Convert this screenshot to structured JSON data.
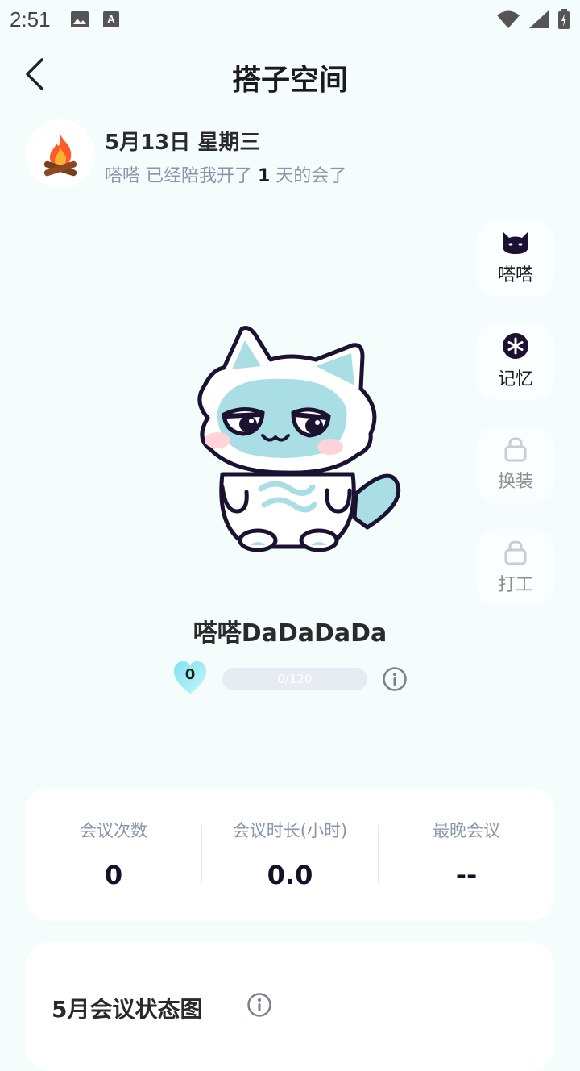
{
  "status_bar": {
    "time": "2:51",
    "icons_left": [
      "image-icon",
      "font-icon"
    ],
    "icons_right": [
      "wifi-icon",
      "signal-icon",
      "battery-icon"
    ]
  },
  "header": {
    "title": "搭子空间",
    "back_icon": "chevron-left-icon"
  },
  "info": {
    "date": "5月13日 星期三",
    "companion_prefix": "嗒嗒 已经陪我开了 ",
    "companion_days": "1",
    "companion_suffix": " 天的会了",
    "avatar_icon": "campfire-icon"
  },
  "side_menu": [
    {
      "label": "嗒嗒",
      "icon": "cat-head-icon",
      "locked": false
    },
    {
      "label": "记忆",
      "icon": "asterisk-icon",
      "locked": false
    },
    {
      "label": "换装",
      "icon": "lock-icon",
      "locked": true
    },
    {
      "label": "打工",
      "icon": "lock-icon",
      "locked": true
    }
  ],
  "pet": {
    "name": "嗒嗒DaDaDaDa",
    "level": "0",
    "progress_text": "0/120",
    "progress_fraction": 0
  },
  "stats": [
    {
      "label": "会议次数",
      "value": "0"
    },
    {
      "label": "会议时长(小时)",
      "value": "0.0"
    },
    {
      "label": "最晚会议",
      "value": "--"
    }
  ],
  "month_chart": {
    "title": "5月会议状态图"
  },
  "colors": {
    "background": "#f5fcfc",
    "accent": "#b7e8ea",
    "subtle_text": "#8a96a9"
  }
}
